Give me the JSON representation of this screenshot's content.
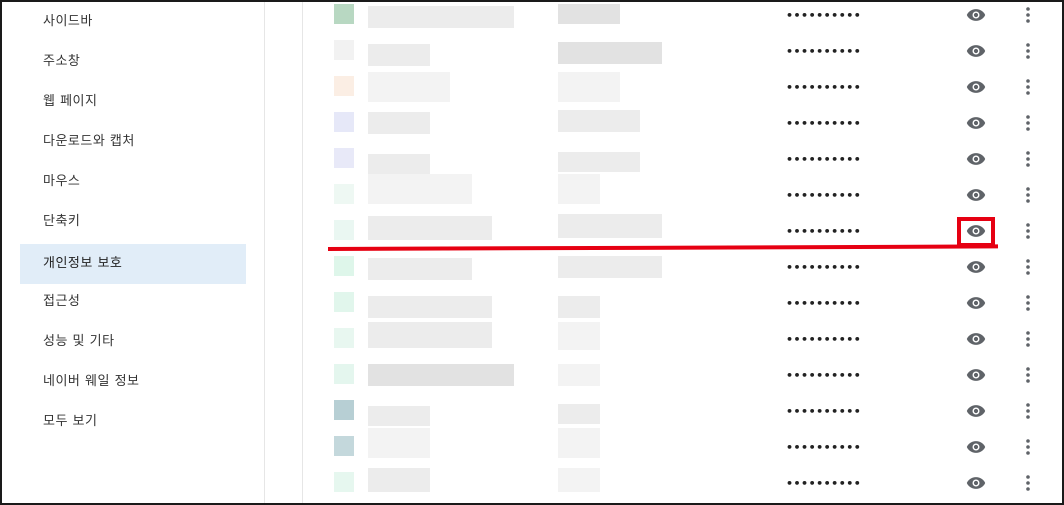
{
  "sidebar": {
    "items": [
      {
        "label": "사이드바",
        "active": false
      },
      {
        "label": "주소창",
        "active": false
      },
      {
        "label": "웹 페이지",
        "active": false
      },
      {
        "label": "다운로드와 캡처",
        "active": false
      },
      {
        "label": "마우스",
        "active": false
      },
      {
        "label": "단축키",
        "active": false
      },
      {
        "label": "개인정보 보호",
        "active": true
      },
      {
        "label": "접근성",
        "active": false
      },
      {
        "label": "성능 및 기타",
        "active": false
      },
      {
        "label": "네이버 웨일 정보",
        "active": false
      },
      {
        "label": "모두 보기",
        "active": false
      }
    ]
  },
  "password_list": {
    "masked_password": "••••••••••",
    "show_icon": "eye-icon",
    "more_icon": "more-vert-icon",
    "row_count": 14,
    "highlighted_row": 7
  },
  "colors": {
    "active_item_bg": "#e1edf8",
    "highlight_red": "#e60012"
  }
}
